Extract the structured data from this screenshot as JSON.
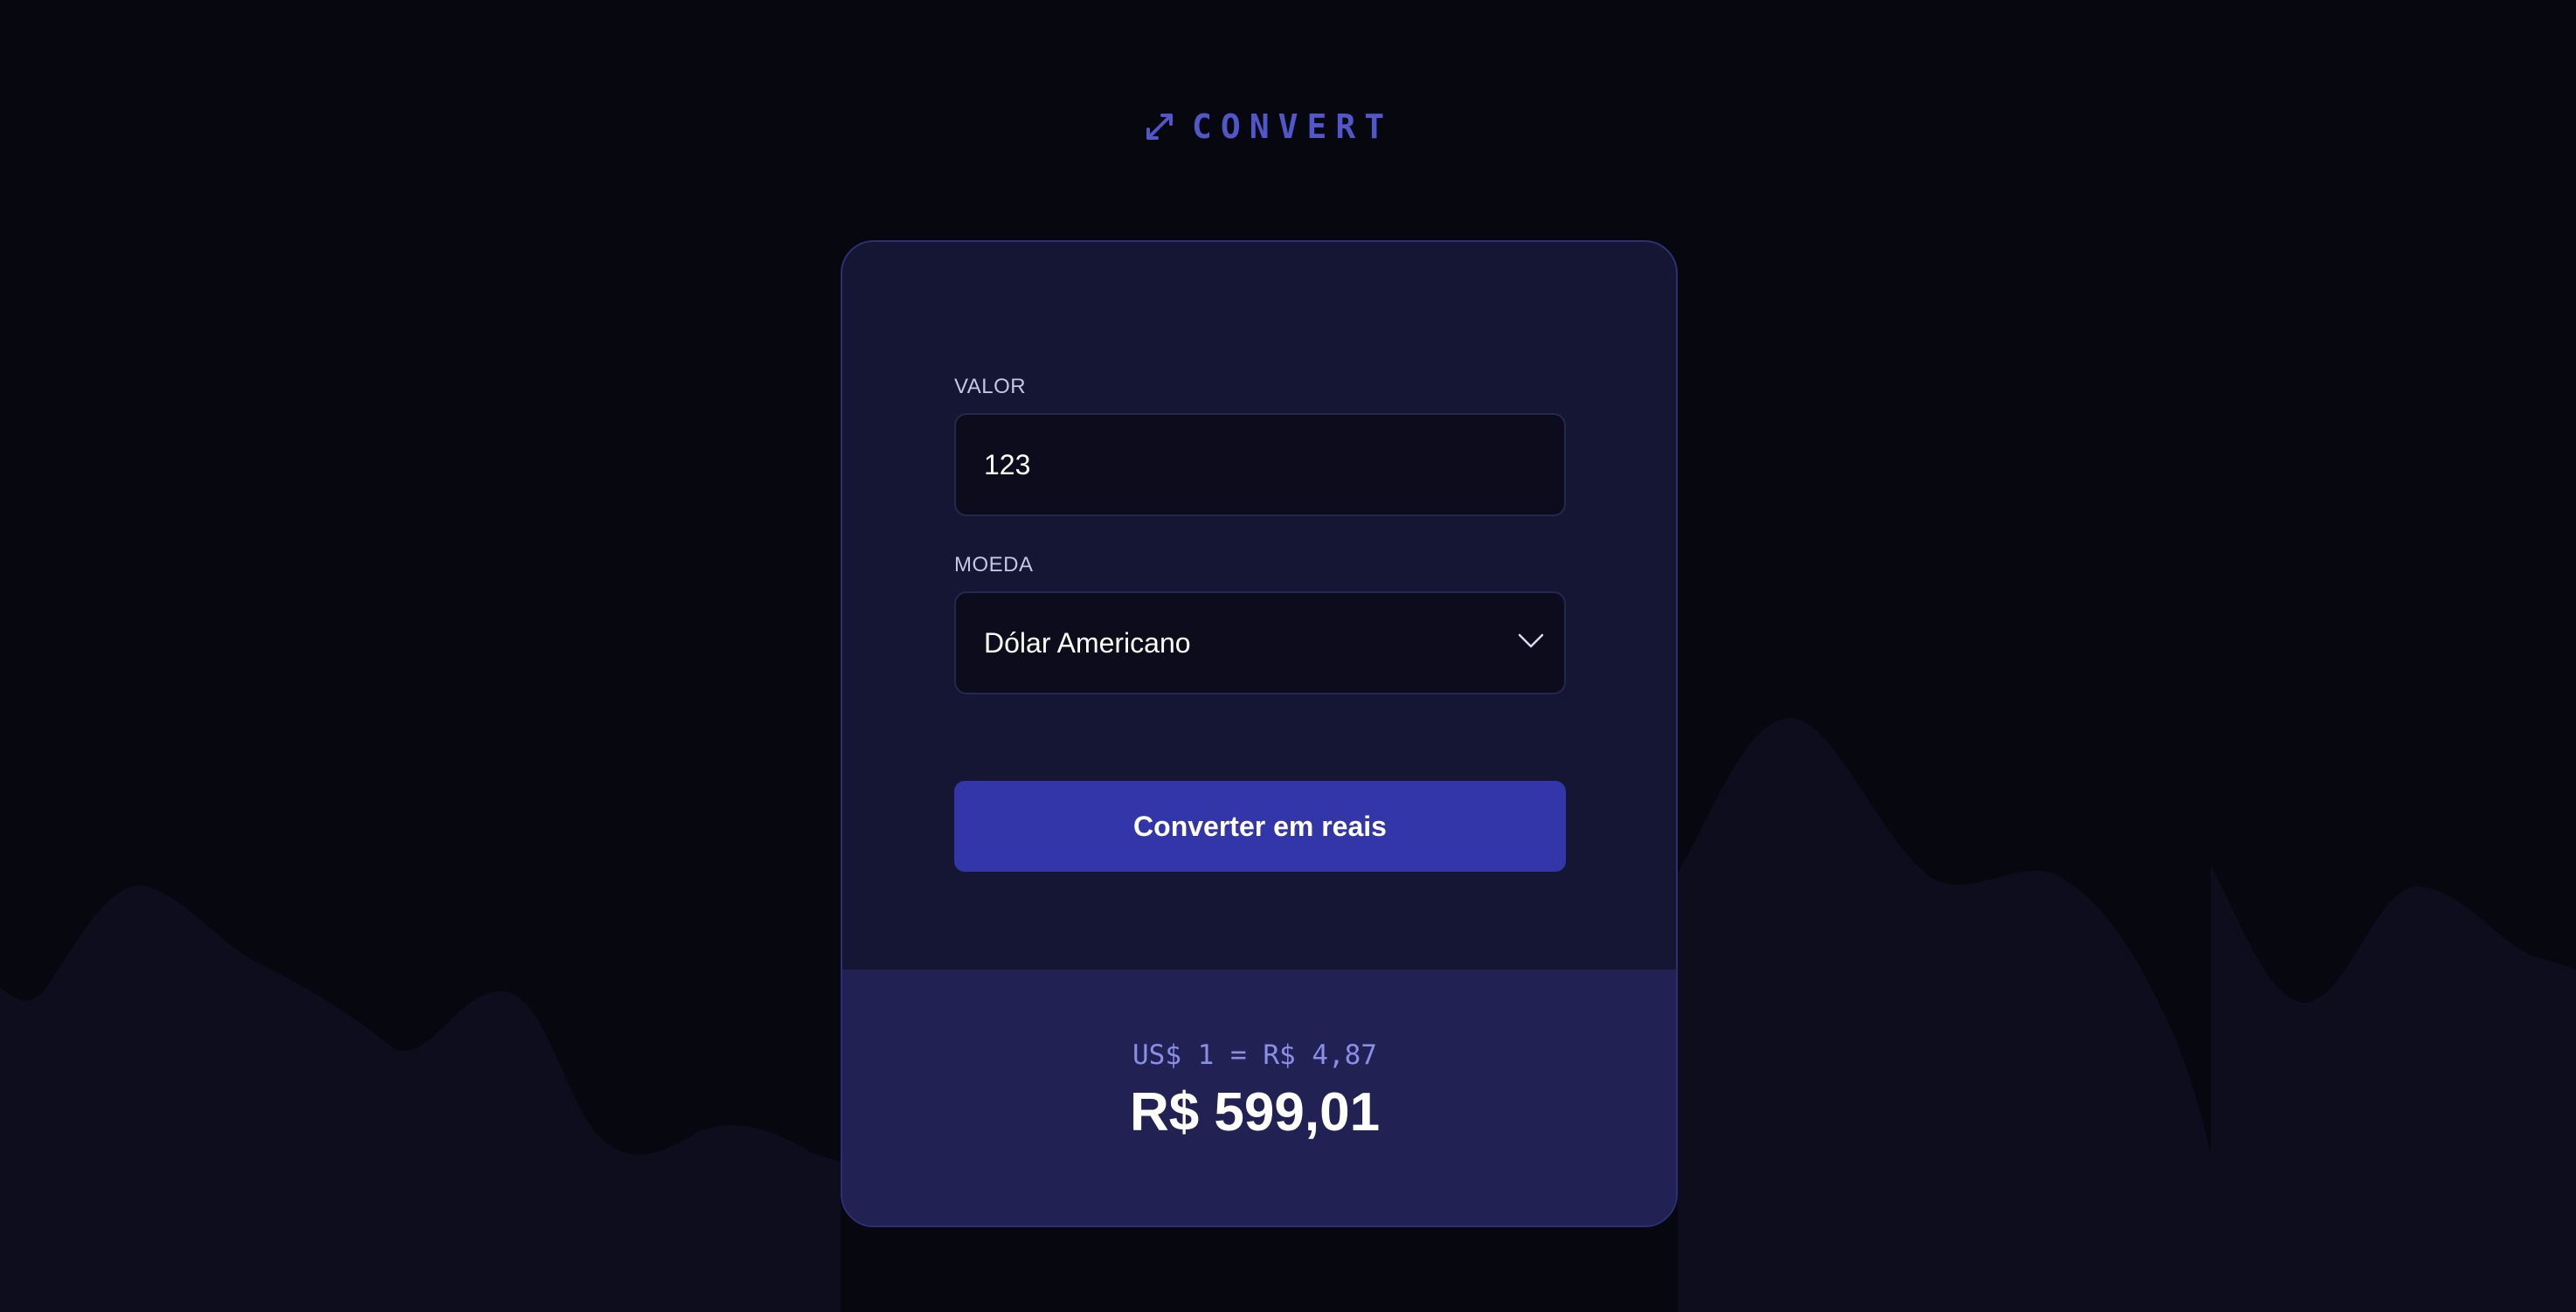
{
  "brand": {
    "logo_text": "CONVERT",
    "icon": "exchange-arrows-icon",
    "accent_color": "#5156c8"
  },
  "form": {
    "amount_label": "VALOR",
    "amount_value": "123",
    "currency_label": "MOEDA",
    "currency_selected": "Dólar Americano",
    "submit_label": "Converter em reais",
    "button_color": "#3336a8"
  },
  "result": {
    "rate_text": "US$ 1 = R$ 4,87",
    "total_text": "R$ 599,01"
  },
  "colors": {
    "background": "#07070f",
    "card": "#151633",
    "result_panel": "#212253"
  }
}
